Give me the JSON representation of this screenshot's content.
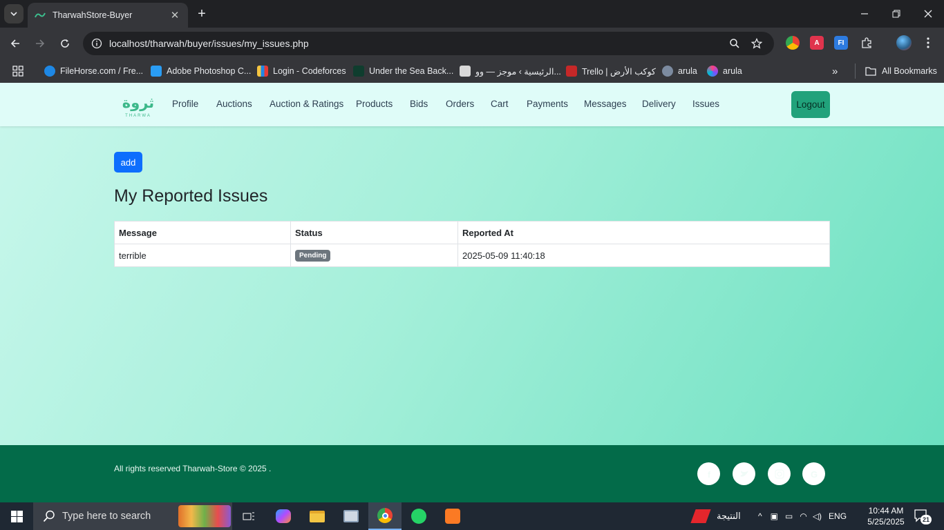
{
  "browser": {
    "tab_title": "TharwahStore-Buyer",
    "url": "localhost/tharwah/buyer/issues/my_issues.php",
    "bookmarks": [
      "FileHorse.com / Fre...",
      "Adobe Photoshop C...",
      "Login - Codeforces",
      "Under the Sea Back...",
      "الرئيسية › موجز — وو...",
      "Trello | كوكب الأرض",
      "arula",
      "arula"
    ],
    "all_bookmarks": "All Bookmarks"
  },
  "site": {
    "brand": "ثروة",
    "brand_sub": "THARWA",
    "nav": [
      "Profile",
      "Auctions",
      "Auction & Ratings",
      "Products",
      "Bids",
      "Orders",
      "Cart",
      "Payments",
      "Messages",
      "Delivery",
      "Issues"
    ],
    "logout": "Logout"
  },
  "main": {
    "add_label": "add",
    "title": "My Reported Issues",
    "table": {
      "headers": [
        "Message",
        "Status",
        "Reported At"
      ],
      "rows": [
        {
          "message": "terrible",
          "status": "Pending",
          "reported_at": "2025-05-09 11:40:18"
        }
      ]
    }
  },
  "footer": {
    "copyright": "All rights reserved Tharwah-Store © 2025 .",
    "social": [
      "facebook-icon",
      "twitter-icon",
      "instagram-icon",
      "google-icon"
    ]
  },
  "taskbar": {
    "search_placeholder": "Type here to search",
    "weather_label": "النتيجة",
    "language": "ENG",
    "time": "10:44 AM",
    "date": "5/25/2025",
    "notifications": "21"
  },
  "colors": {
    "accent_green": "#21a27b",
    "footer_green": "#036b49",
    "primary_blue": "#0d6efd",
    "badge_gray": "#6c757d"
  }
}
